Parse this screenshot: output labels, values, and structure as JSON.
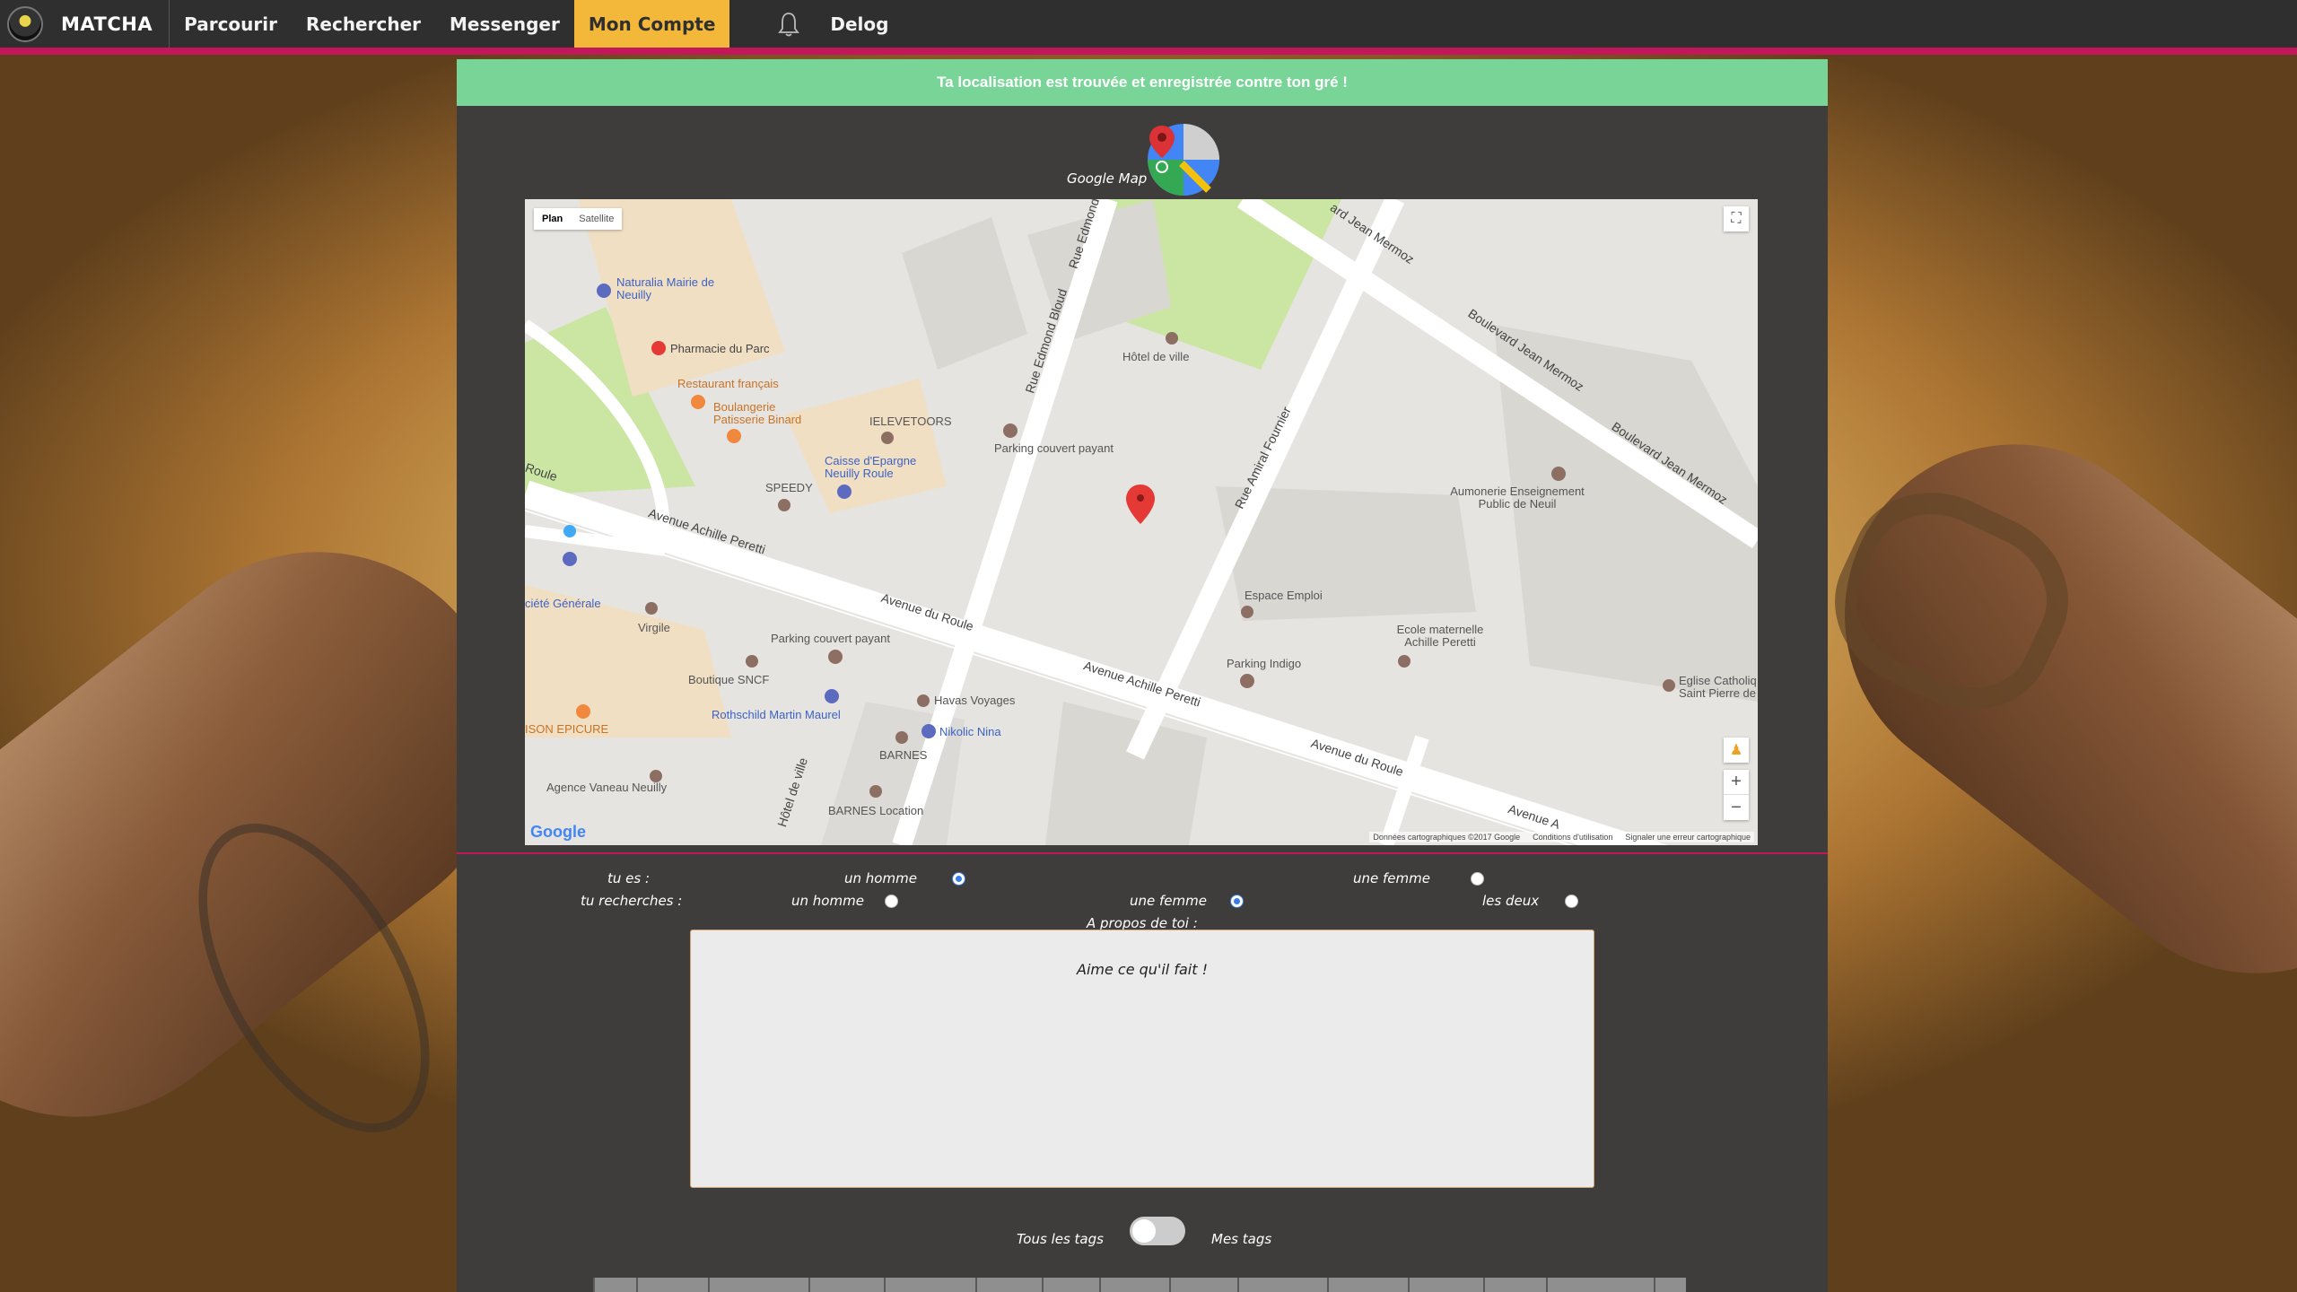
{
  "nav": {
    "brand": "MATCHA",
    "items": [
      "Parcourir",
      "Rechercher",
      "Messenger",
      "Mon Compte"
    ],
    "active": "Mon Compte",
    "logout": "Delog"
  },
  "alert": "Ta localisation est trouvée et enregistrée contre ton gré !",
  "map_section": {
    "label": "Google Map",
    "map_type_plan": "Plan",
    "map_type_satellite": "Satellite",
    "google": "Google",
    "attribution": [
      "Données cartographiques ©2017 Google",
      "Conditions d'utilisation",
      "Signaler une erreur cartographique"
    ],
    "labels": {
      "naturalia": "Naturalia Mairie de Neuilly",
      "pharmacie": "Pharmacie du Parc",
      "restaurant": "Restaurant français",
      "boulangerie": "Boulangerie Patisserie Binard",
      "ielevetoors": "IELEVETOORS",
      "caisse": "Caisse d'Epargne Neuilly Roule",
      "speedy": "SPEEDY",
      "hotel_de_ville": "Hôtel de ville",
      "parking1": "Parking couvert payant",
      "aumonerie": "Aumonerie Enseignement Public de Neuil",
      "societe": "ciété Générale",
      "virgile": "Virgile",
      "parking2": "Parking couvert payant",
      "boutique": "Boutique SNCF",
      "rothschild": "Rothschild Martin Maurel",
      "havas": "Havas Voyages",
      "nikolic": "Nikolic Nina",
      "barnes": "BARNES",
      "barnes_loc": "BARNES Location",
      "epicure": "ISON EPICURE",
      "agence": "Agence Vaneau Neuilly",
      "espace": "Espace Emploi",
      "parking_indigo": "Parking Indigo",
      "ecole": "Ecole maternelle Achille Peretti",
      "eglise": "Eglise Catholiq Saint Pierre de",
      "roads": {
        "achille1": "Avenue Achille Peretti",
        "achille2": "Avenue Achille Peretti",
        "achille3": "Avenue A",
        "roule1": "Avenue du Roule",
        "roule2": "Avenue du Roule",
        "roule3": "Roule",
        "bloud": "Rue Edmond Bloud",
        "edmond": "Rue Edmond",
        "amiral": "Rue Amiral Fournier",
        "mermoz1": "Boulevard Jean Mermoz",
        "mermoz2": "Boulevard Jean Mermoz",
        "mermoz3": "ard Jean Mermoz",
        "hotel_ville_rue": "Hôtel de ville"
      }
    }
  },
  "form": {
    "tu_es": "tu es :",
    "tu_recherches": "tu recherches :",
    "un_homme_1": "un homme",
    "une_femme_1": "une femme",
    "un_homme_2": "un homme",
    "une_femme_2": "une femme",
    "les_deux": "les deux",
    "gender_selected": "un homme",
    "search_selected": "une femme",
    "about_label": "A propos de toi :",
    "about_value": "Aime ce qu'il fait !",
    "tags_all": "Tous les tags",
    "tags_mine": "Mes tags"
  },
  "colors": {
    "nav_bg": "#2f2f2f",
    "accent": "#c2185b",
    "active_tab": "#f3b73a",
    "alert": "#79d597",
    "panel": "#3f3d3c"
  }
}
